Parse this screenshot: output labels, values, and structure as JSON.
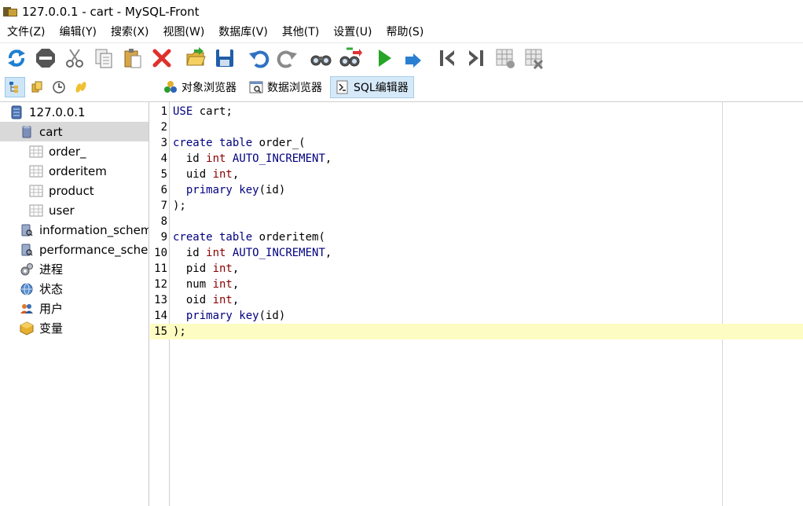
{
  "window": {
    "title": "127.0.0.1 - cart - MySQL-Front"
  },
  "menu": [
    "文件(Z)",
    "编辑(Y)",
    "搜索(X)",
    "视图(W)",
    "数据库(V)",
    "其他(T)",
    "设置(U)",
    "帮助(S)"
  ],
  "toolbar_icons": [
    "refresh-icon",
    "stop-icon",
    "cut-icon",
    "copy-icon",
    "paste-icon",
    "delete-icon",
    "open-folder-icon",
    "save-icon",
    "undo-icon",
    "redo-icon",
    "find-icon",
    "replace-icon",
    "run-icon",
    "run-selection-icon",
    "first-record-icon",
    "last-record-icon",
    "insert-record-icon",
    "delete-record-icon"
  ],
  "sidebar_icons": [
    "tree-view-icon",
    "bookmarks-icon",
    "history-icon",
    "sql-history-icon"
  ],
  "view_tabs": [
    {
      "label": "对象浏览器",
      "icon": "object-browser-icon",
      "active": false
    },
    {
      "label": "数据浏览器",
      "icon": "data-browser-icon",
      "active": false
    },
    {
      "label": "SQL编辑器",
      "icon": "sql-editor-icon",
      "active": true
    }
  ],
  "tree": [
    {
      "label": "127.0.0.1",
      "icon": "server-icon",
      "level": 0,
      "selected": false
    },
    {
      "label": "cart",
      "icon": "database-icon",
      "level": 1,
      "selected": true
    },
    {
      "label": "order_",
      "icon": "table-icon",
      "level": 2,
      "selected": false
    },
    {
      "label": "orderitem",
      "icon": "table-icon",
      "level": 2,
      "selected": false
    },
    {
      "label": "product",
      "icon": "table-icon",
      "level": 2,
      "selected": false
    },
    {
      "label": "user",
      "icon": "table-icon",
      "level": 2,
      "selected": false
    },
    {
      "label": "information_schem",
      "icon": "system-database-icon",
      "level": 1,
      "selected": false
    },
    {
      "label": "performance_scher",
      "icon": "system-database-icon",
      "level": 1,
      "selected": false
    },
    {
      "label": "进程",
      "icon": "processes-icon",
      "level": 1,
      "selected": false
    },
    {
      "label": "状态",
      "icon": "status-icon",
      "level": 1,
      "selected": false
    },
    {
      "label": "用户",
      "icon": "users-icon",
      "level": 1,
      "selected": false
    },
    {
      "label": "变量",
      "icon": "variables-icon",
      "level": 1,
      "selected": false
    }
  ],
  "editor": {
    "current_line": 15,
    "lines": [
      [
        [
          "kw",
          "USE"
        ],
        [
          "tx",
          " cart;"
        ]
      ],
      [],
      [
        [
          "kw",
          "create table"
        ],
        [
          "tx",
          " order_("
        ]
      ],
      [
        [
          "tx",
          "  id "
        ],
        [
          "dt",
          "int"
        ],
        [
          "tx",
          " "
        ],
        [
          "kw",
          "AUTO_INCREMENT"
        ],
        [
          "tx",
          ","
        ]
      ],
      [
        [
          "tx",
          "  uid "
        ],
        [
          "dt",
          "int"
        ],
        [
          "tx",
          ","
        ]
      ],
      [
        [
          "tx",
          "  "
        ],
        [
          "kw",
          "primary key"
        ],
        [
          "tx",
          "(id)"
        ]
      ],
      [
        [
          "tx",
          ");"
        ]
      ],
      [],
      [
        [
          "kw",
          "create table"
        ],
        [
          "tx",
          " orderitem("
        ]
      ],
      [
        [
          "tx",
          "  id "
        ],
        [
          "dt",
          "int"
        ],
        [
          "tx",
          " "
        ],
        [
          "kw",
          "AUTO_INCREMENT"
        ],
        [
          "tx",
          ","
        ]
      ],
      [
        [
          "tx",
          "  pid "
        ],
        [
          "dt",
          "int"
        ],
        [
          "tx",
          ","
        ]
      ],
      [
        [
          "tx",
          "  num "
        ],
        [
          "dt",
          "int"
        ],
        [
          "tx",
          ","
        ]
      ],
      [
        [
          "tx",
          "  oid "
        ],
        [
          "dt",
          "int"
        ],
        [
          "tx",
          ","
        ]
      ],
      [
        [
          "tx",
          "  "
        ],
        [
          "kw",
          "primary key"
        ],
        [
          "tx",
          "(id)"
        ]
      ],
      [
        [
          "tx",
          ");"
        ]
      ]
    ]
  }
}
